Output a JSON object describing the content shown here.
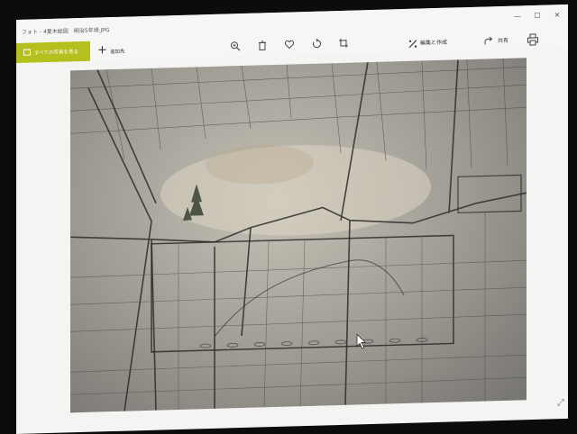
{
  "window": {
    "title": "フォト - 4夏木絵図　明治5年頃.JPG",
    "controls": [
      "—",
      "☐",
      "✕"
    ]
  },
  "toolbar": {
    "all_photos_label": "すべての写真を見る",
    "add_label": "追加先",
    "edit_label": "編集と作成",
    "share_label": "共有",
    "icons": [
      "zoom-icon",
      "delete-icon",
      "favorite-icon",
      "rotate-icon",
      "crop-icon"
    ]
  },
  "photo": {
    "description_visible": false
  }
}
